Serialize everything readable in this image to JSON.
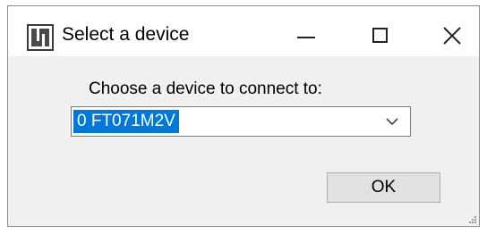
{
  "window": {
    "title": "Select a device",
    "icons": {
      "app": "app-icon",
      "minimize": "minimize-icon",
      "maximize": "maximize-icon",
      "close": "close-icon"
    }
  },
  "dialog": {
    "prompt": "Choose a device to connect to:",
    "device_select": {
      "selected_value": "0 FT071M2V",
      "dropdown_icon": "chevron-down-icon"
    },
    "ok_label": "OK"
  },
  "colors": {
    "selection_highlight": "#0078d7",
    "window_background": "#f0f0f0",
    "titlebar_background": "#ffffff"
  }
}
